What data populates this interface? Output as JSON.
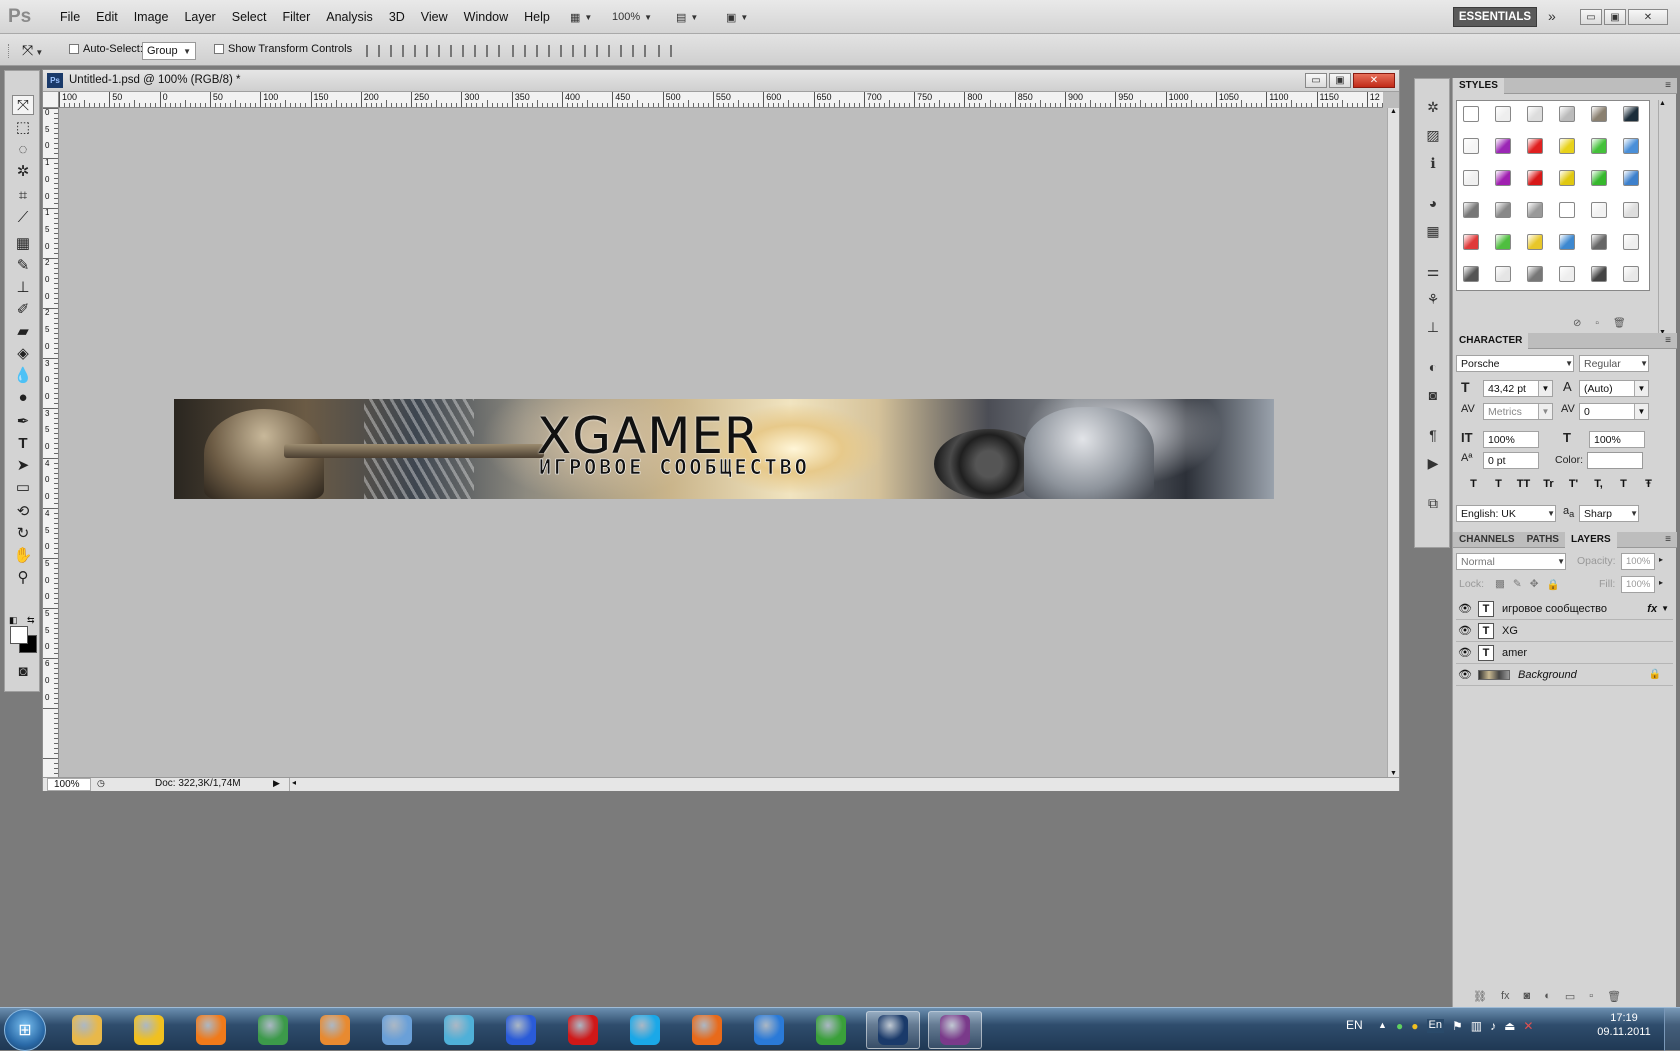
{
  "app": {
    "logo": "Ps"
  },
  "menu": [
    "File",
    "Edit",
    "Image",
    "Layer",
    "Select",
    "Filter",
    "Analysis",
    "3D",
    "View",
    "Window",
    "Help"
  ],
  "menubar": {
    "zoom": "100%",
    "workspace": "ESSENTIALS",
    "win_min": "▭",
    "win_max": "▣",
    "win_close": "✕"
  },
  "options": {
    "auto_select_label": "Auto-Select:",
    "auto_select_value": "Group",
    "transform_label": "Show Transform Controls"
  },
  "document": {
    "title": "Untitled-1.psd @ 100% (RGB/8) *",
    "zoom": "100%",
    "doc_info": "Doc: 322,3K/1,74M",
    "ruler_labels": [
      "100",
      "50",
      "0",
      "50",
      "100",
      "150",
      "200",
      "250",
      "300",
      "350",
      "400",
      "450",
      "500",
      "550",
      "600",
      "650",
      "700",
      "750",
      "800",
      "850",
      "900",
      "950",
      "1000",
      "1050",
      "1100",
      "1150",
      "12"
    ],
    "vruler_labels": [
      "0",
      "5",
      "0",
      "1",
      "0",
      "0",
      "1",
      "5",
      "0",
      "2",
      "0",
      "0",
      "2",
      "5",
      "0",
      "3",
      "0",
      "0",
      "3",
      "5",
      "0",
      "4",
      "0",
      "0",
      "4",
      "5",
      "0",
      "5",
      "0",
      "0",
      "5",
      "5",
      "0",
      "6",
      "0",
      "0"
    ]
  },
  "banner": {
    "title": "XGAMER",
    "subtitle": "ИГРОВОЕ СООБЩЕСТВО"
  },
  "panels": {
    "styles_tab": "STYLES",
    "character_tab": "CHARACTER",
    "channels_tab": "CHANNELS",
    "paths_tab": "PATHS",
    "layers_tab": "LAYERS"
  },
  "character": {
    "font": "Porsche",
    "style": "Regular",
    "size": "43,42 pt",
    "leading": "(Auto)",
    "kerning": "Metrics",
    "tracking": "0",
    "vscale": "100%",
    "hscale": "100%",
    "baseline": "0 pt",
    "color_label": "Color:",
    "type_buttons": [
      "T",
      "T",
      "TT",
      "Tr",
      "T'",
      "T,",
      "T",
      "Ŧ"
    ],
    "language": "English: UK",
    "aa_label": "a",
    "antialias": "Sharp"
  },
  "layers_panel": {
    "blend_mode": "Normal",
    "opacity_label": "Opacity:",
    "opacity": "100%",
    "lock_label": "Lock:",
    "fill_label": "Fill:",
    "fill": "100%",
    "layers": [
      {
        "name": "игровое сообщество",
        "kind": "T",
        "fx": "fx"
      },
      {
        "name": "XG",
        "kind": "T"
      },
      {
        "name": "amer",
        "kind": "T"
      },
      {
        "name": "Background",
        "kind": "image"
      }
    ]
  },
  "style_swatches": [
    [
      "#ffffff",
      "#eeeeee",
      "#dddddd",
      "#bbbbbb",
      "#8a8070",
      "#1c2d3a"
    ],
    [
      "#f5f5f5",
      "#9b27b5",
      "#e02020",
      "#e8d21a",
      "#44c13a",
      "#4a8fd8"
    ],
    [
      "#f0f0f0",
      "#a020b0",
      "#d81818",
      "#e0c810",
      "#36b82d",
      "#3d80cc"
    ],
    [
      "#777777",
      "#888888",
      "#999999",
      "#ffffff",
      "#f2f2f2",
      "#dddddd"
    ],
    [
      "#e03a3a",
      "#4fbe3f",
      "#e8c72a",
      "#3d88d0",
      "#666666",
      "#eeeeee"
    ],
    [
      "#555555",
      "#e5e5e5",
      "#777777",
      "#eeeeee",
      "#444444",
      "#e8e8e8"
    ]
  ],
  "taskbar": {
    "lang": "EN",
    "tray_lang": "En",
    "time": "17:19",
    "date": "09.11.2011",
    "apps": [
      {
        "name": "explorer",
        "color": "#e8b84a"
      },
      {
        "name": "aimp",
        "color": "#f0c020"
      },
      {
        "name": "mail-agent",
        "color": "#f07a1a"
      },
      {
        "name": "chrome",
        "color": "#3c9a4a"
      },
      {
        "name": "media-player",
        "color": "#e88a30"
      },
      {
        "name": "downloader",
        "color": "#6aa0d8"
      },
      {
        "name": "notes",
        "color": "#4fb0d8"
      },
      {
        "name": "save-app",
        "color": "#2a5bd8"
      },
      {
        "name": "opera",
        "color": "#d01818"
      },
      {
        "name": "skype",
        "color": "#1aa8e8"
      },
      {
        "name": "firefox",
        "color": "#e86a1a"
      },
      {
        "name": "internet-explorer",
        "color": "#2a7ad8"
      },
      {
        "name": "utorrent",
        "color": "#3aa03a"
      },
      {
        "name": "photoshop",
        "color": "#1a3a6a"
      },
      {
        "name": "winrar",
        "color": "#7a3a8a"
      }
    ]
  }
}
